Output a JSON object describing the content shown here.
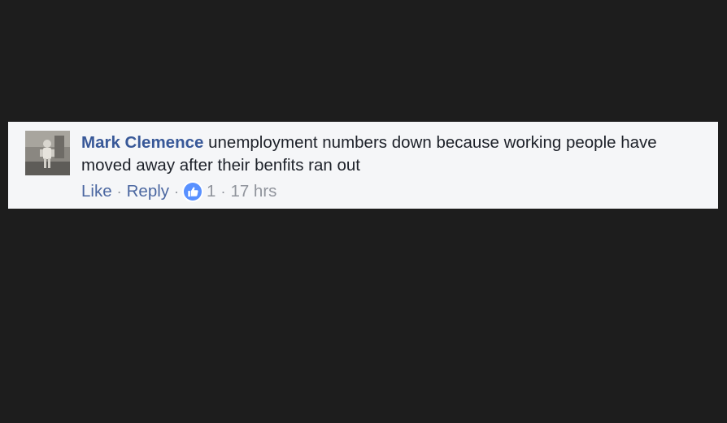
{
  "comment": {
    "author": "Mark Clemence",
    "text": "unemployment numbers down because working people have moved away after their benfits ran out",
    "actions": {
      "like_label": "Like",
      "reply_label": "Reply",
      "separator": "·",
      "like_count": "1",
      "timestamp": "17 hrs"
    },
    "avatar_icon": "profile-photo",
    "like_reaction_icon": "thumbs-up-icon"
  },
  "colors": {
    "background": "#1d1d1d",
    "card": "#f5f6f8",
    "author_link": "#385898",
    "action_link": "#4b67a1",
    "meta_text": "#90949c",
    "like_badge": "#5890ff"
  }
}
